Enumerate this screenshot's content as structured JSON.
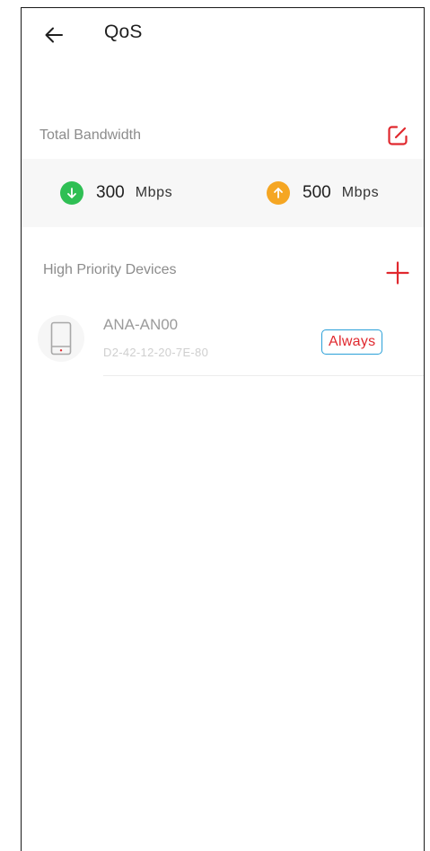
{
  "header": {
    "title": "QoS",
    "back_icon": "arrow-left-icon"
  },
  "bandwidth": {
    "label": "Total Bandwidth",
    "edit_icon": "edit-icon",
    "download": {
      "icon": "download-arrow-icon",
      "color": "#2fbf54",
      "value": "300",
      "unit": "Mbps"
    },
    "upload": {
      "icon": "upload-arrow-icon",
      "color": "#f5a623",
      "value": "500",
      "unit": "Mbps"
    }
  },
  "priority": {
    "label": "High Priority Devices",
    "add_icon": "plus-icon",
    "devices": [
      {
        "name": "ANA-AN00",
        "mac": "D2-42-12-20-7E-80",
        "icon": "phone-icon",
        "schedule": "Always"
      }
    ]
  },
  "colors": {
    "accent": "#e0282e",
    "badge_border": "#2aa0d8"
  }
}
